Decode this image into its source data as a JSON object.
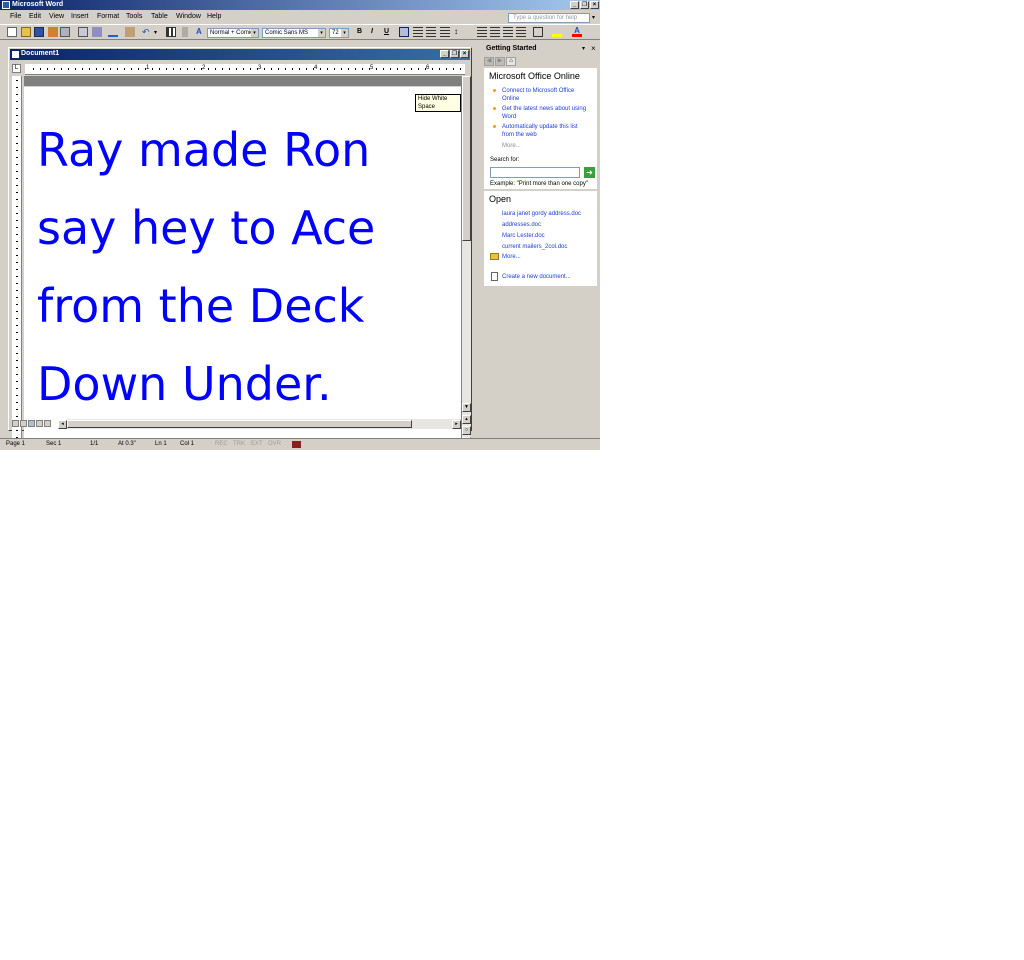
{
  "window": {
    "title": "Microsoft Word"
  },
  "menu": {
    "items": [
      "File",
      "Edit",
      "View",
      "Insert",
      "Format",
      "Tools",
      "Table",
      "Window",
      "Help"
    ]
  },
  "help_box": {
    "placeholder": "Type a question for help"
  },
  "toolbar": {
    "style_value": "Normal + Comic",
    "font_value": "Comic Sans MS",
    "size_value": "72",
    "bold_label": "B",
    "italic_label": "I",
    "underline_label": "U"
  },
  "document": {
    "title": "Document1",
    "lines": [
      "Ray made Ron",
      "say hey to Ace",
      "from the Deck",
      "Down Under."
    ],
    "tooltip": "Hide White Space",
    "ruler_numbers": [
      "1",
      "2",
      "3",
      "4",
      "5",
      "6",
      "7"
    ]
  },
  "taskpane": {
    "title": "Getting Started",
    "online_heading": "Microsoft Office Online",
    "online_links": [
      "Connect to Microsoft Office Online",
      "Get the latest news about using Word",
      "Automatically update this list from the web"
    ],
    "more_label": "More...",
    "search_label": "Search for:",
    "search_example": "Example: \"Print more than one copy\"",
    "open_heading": "Open",
    "recent_files": [
      "laura janet gordy address.doc",
      "addresses.doc",
      "Marc Lester.doc",
      "current mailers_2col.doc"
    ],
    "open_more": "More...",
    "create_new": "Create a new document..."
  },
  "status": {
    "page": "Page 1",
    "sec": "Sec 1",
    "pages": "1/1",
    "at": "At 0.3\"",
    "ln": "Ln 1",
    "col": "Col 1",
    "rec": "REC",
    "trk": "TRK",
    "ext": "EXT",
    "ovr": "OVR"
  }
}
